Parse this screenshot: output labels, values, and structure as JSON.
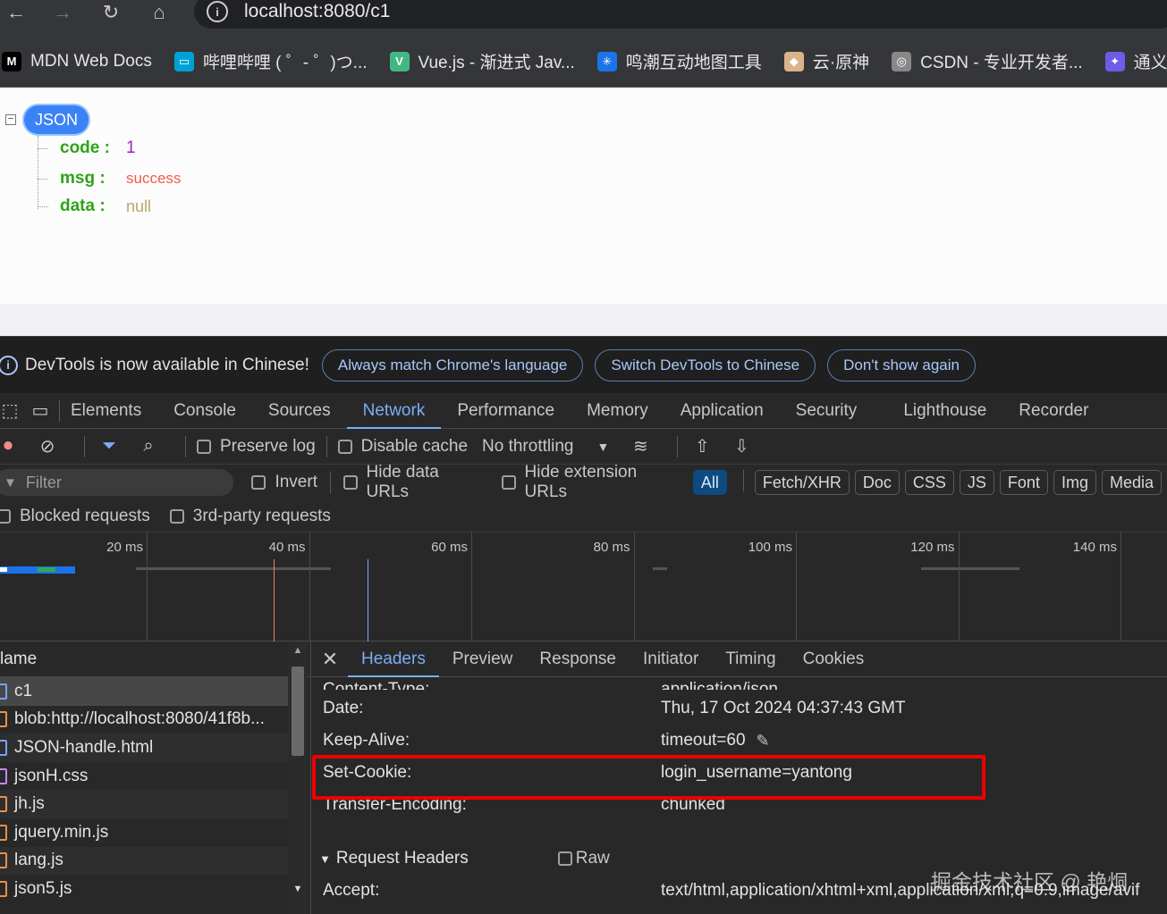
{
  "browser": {
    "url": "localhost:8080/c1",
    "bookmarks": [
      {
        "label": "MDN Web Docs",
        "icon": "mdn-icon",
        "color": "#000000",
        "glyph": "M"
      },
      {
        "label": "哔哩哔哩 ( ゜- ゜)つ...",
        "icon": "bilibili-icon",
        "color": "#00a1d6",
        "glyph": "▭"
      },
      {
        "label": "Vue.js - 渐进式 Jav...",
        "icon": "vue-icon",
        "color": "#41b883",
        "glyph": "V"
      },
      {
        "label": "鸣潮互动地图工具",
        "icon": "map-tool-icon",
        "color": "#1a73e8",
        "glyph": "✳"
      },
      {
        "label": "云·原神",
        "icon": "genshin-icon",
        "color": "#d9b48a",
        "glyph": "◆"
      },
      {
        "label": "CSDN - 专业开发者...",
        "icon": "globe-icon",
        "color": "#888888",
        "glyph": "◎"
      },
      {
        "label": "通义tong",
        "icon": "tongyi-icon",
        "color": "#6c5ce7",
        "glyph": "✦"
      }
    ]
  },
  "page": {
    "root_label": "JSON",
    "toggle": "−",
    "fields": [
      {
        "key": "code :",
        "value": "1",
        "kind": "num"
      },
      {
        "key": "msg :",
        "value": "success",
        "kind": "str"
      },
      {
        "key": "data :",
        "value": "null",
        "kind": "null"
      }
    ]
  },
  "devtools": {
    "banner": {
      "message": "DevTools is now available in Chinese!",
      "buttons": [
        "Always match Chrome's language",
        "Switch DevTools to Chinese",
        "Don't show again"
      ]
    },
    "tabs": [
      "Elements",
      "Console",
      "Sources",
      "Network",
      "Performance",
      "Memory",
      "Application",
      "Security",
      "Lighthouse",
      "Recorder"
    ],
    "active_tab": "Network",
    "toolbar": {
      "preserve_log": "Preserve log",
      "disable_cache": "Disable cache",
      "throttling": "No throttling"
    },
    "filter": {
      "placeholder": "Filter",
      "invert": "Invert",
      "hide_data_urls": "Hide data URLs",
      "hide_extension_urls": "Hide extension URLs",
      "types": [
        "All",
        "Fetch/XHR",
        "Doc",
        "CSS",
        "JS",
        "Font",
        "Img",
        "Media"
      ],
      "blocked": "Blocked requests",
      "third_party": "3rd-party requests"
    },
    "timeline": {
      "ticks": [
        "20 ms",
        "40 ms",
        "60 ms",
        "80 ms",
        "100 ms",
        "120 ms",
        "140 ms"
      ]
    },
    "requests": {
      "header": "lame",
      "rows": [
        {
          "name": "c1",
          "type": "doc"
        },
        {
          "name": "blob:http://localhost:8080/41f8b...",
          "type": "js"
        },
        {
          "name": "JSON-handle.html",
          "type": "doc"
        },
        {
          "name": "jsonH.css",
          "type": "css"
        },
        {
          "name": "jh.js",
          "type": "js"
        },
        {
          "name": "jquery.min.js",
          "type": "js"
        },
        {
          "name": "lang.js",
          "type": "js"
        },
        {
          "name": "json5.js",
          "type": "js"
        }
      ]
    },
    "detail": {
      "tabs": [
        "Headers",
        "Preview",
        "Response",
        "Initiator",
        "Timing",
        "Cookies"
      ],
      "active": "Headers",
      "headers": [
        {
          "name": "Content-Type:",
          "value": "application/json"
        },
        {
          "name": "Date:",
          "value": "Thu, 17 Oct 2024 04:37:43 GMT"
        },
        {
          "name": "Keep-Alive:",
          "value": "timeout=60"
        },
        {
          "name": "Set-Cookie:",
          "value": "login_username=yantong"
        },
        {
          "name": "Transfer-Encoding:",
          "value": "chunked"
        }
      ],
      "request_headers_title": "Request Headers",
      "raw_label": "Raw",
      "accept_name": "Accept:",
      "accept_value": "text/html,application/xhtml+xml,application/xml;q=0.9,image/avif"
    },
    "watermark": "掘金技术社区 @ 艳烔"
  }
}
